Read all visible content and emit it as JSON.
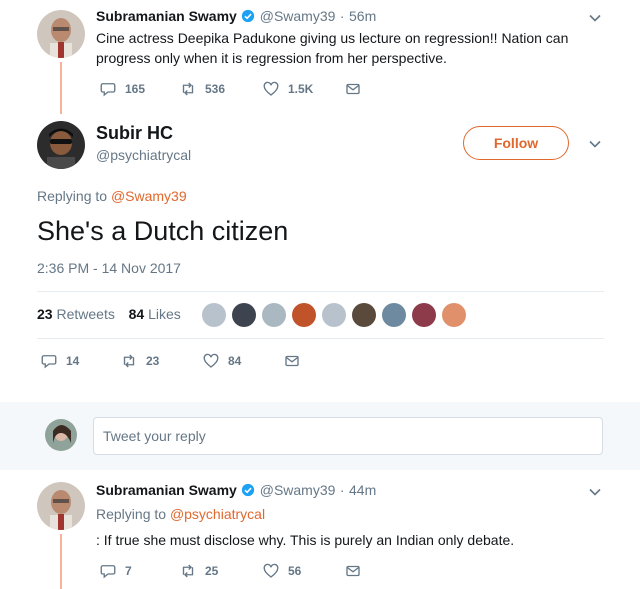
{
  "tweet1": {
    "name": "Subramanian Swamy",
    "handle": "@Swamy39",
    "separator": "·",
    "time": "56m",
    "text": "Cine actress Deepika Padukone giving us lecture on regression!! Nation can progress only when it is regression from her perspective.",
    "replies": "165",
    "retweets": "536",
    "likes": "1.5K"
  },
  "main": {
    "name": "Subir HC",
    "handle": "@psychiatrycal",
    "follow_label": "Follow",
    "replying_prefix": "Replying to",
    "replying_handle": "@Swamy39",
    "text": "She's a Dutch citizen",
    "timestamp": "2:36 PM - 14 Nov 2017",
    "retweet_count": "23",
    "retweet_label": "Retweets",
    "like_count": "84",
    "like_label": "Likes",
    "replies": "14",
    "retweets": "23",
    "likes": "84"
  },
  "reply_box": {
    "placeholder": "Tweet your reply"
  },
  "tweet3": {
    "name": "Subramanian Swamy",
    "handle": "@Swamy39",
    "separator": "·",
    "time": "44m",
    "replying_prefix": "Replying to",
    "replying_handle": "@psychiatrycal",
    "text": ": If true she must disclose why. This is purely an Indian only debate.",
    "replies": "7",
    "retweets": "25",
    "likes": "56"
  },
  "colors": {
    "accent": "#e0682e",
    "thread_line": "#f5b39a",
    "verified": "#1da1f2",
    "muted": "#657786"
  },
  "icons": [
    "reply-icon",
    "retweet-icon",
    "heart-icon",
    "message-icon",
    "chevron-down-icon",
    "verified-badge-icon"
  ]
}
